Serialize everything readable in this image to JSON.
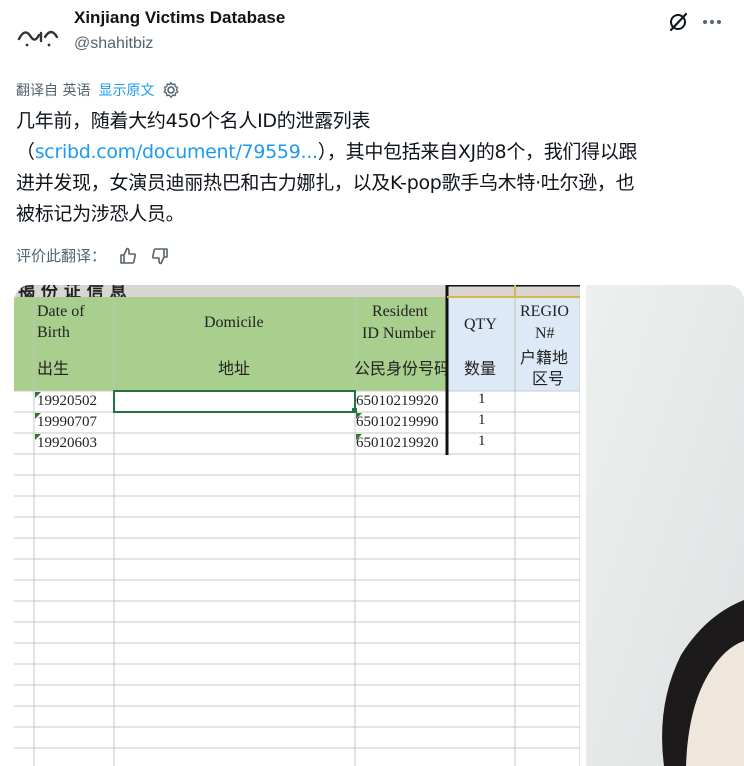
{
  "author": {
    "name": "Xinjiang Victims Database",
    "handle": "@shahitbiz",
    "avatar_text": "شاهت بز"
  },
  "icons": {
    "grok": "grok-icon",
    "more": "more-icon",
    "gear": "gear-icon",
    "thumb_up": "thumb-up-icon",
    "thumb_down": "thumb-down-icon"
  },
  "translation": {
    "label": "翻译自 英语",
    "show_original": "显示原文",
    "rate_label": "评价此翻译："
  },
  "tweet": {
    "line1": "几年前，随着大约450个名人ID的泄露列表",
    "paren_open": "（",
    "url": "scribd.com/document/79559...",
    "line2_rest": "），其中包括来自XJ的8个，我们得以跟",
    "line3": "进并发现，女演员迪丽热巴和古力娜扎，以及K-pop歌手乌木特·吐尔逊，也",
    "line4": "被标记为涉恐人员。"
  },
  "spreadsheet": {
    "cut_title": "揭 份 证 信 息",
    "headers": {
      "dob_en_1": "Date of",
      "dob_en_2": "Birth",
      "dob_zh": "出生",
      "domicile_en": "Domicile",
      "domicile_zh": "地址",
      "resident_en_1": "Resident",
      "resident_en_2": "ID Number",
      "resident_zh": "公民身份号码",
      "qty_en": "QTY",
      "qty_zh": "数量",
      "region_en_1": "REGIO",
      "region_en_2": "N#",
      "region_zh_1": "户籍地",
      "region_zh_2": "区号"
    },
    "rows": [
      {
        "dob": "19920502",
        "id": "65010219920",
        "qty": "1"
      },
      {
        "dob": "19990707",
        "id": "65010219990",
        "qty": "1"
      },
      {
        "dob": "19920603",
        "id": "65010219920",
        "qty": "1"
      }
    ]
  },
  "colors": {
    "link": "#1d9bf0",
    "secondary_text": "#536471",
    "header_green": "#a9cf8e",
    "header_blue": "#dde9f6"
  }
}
